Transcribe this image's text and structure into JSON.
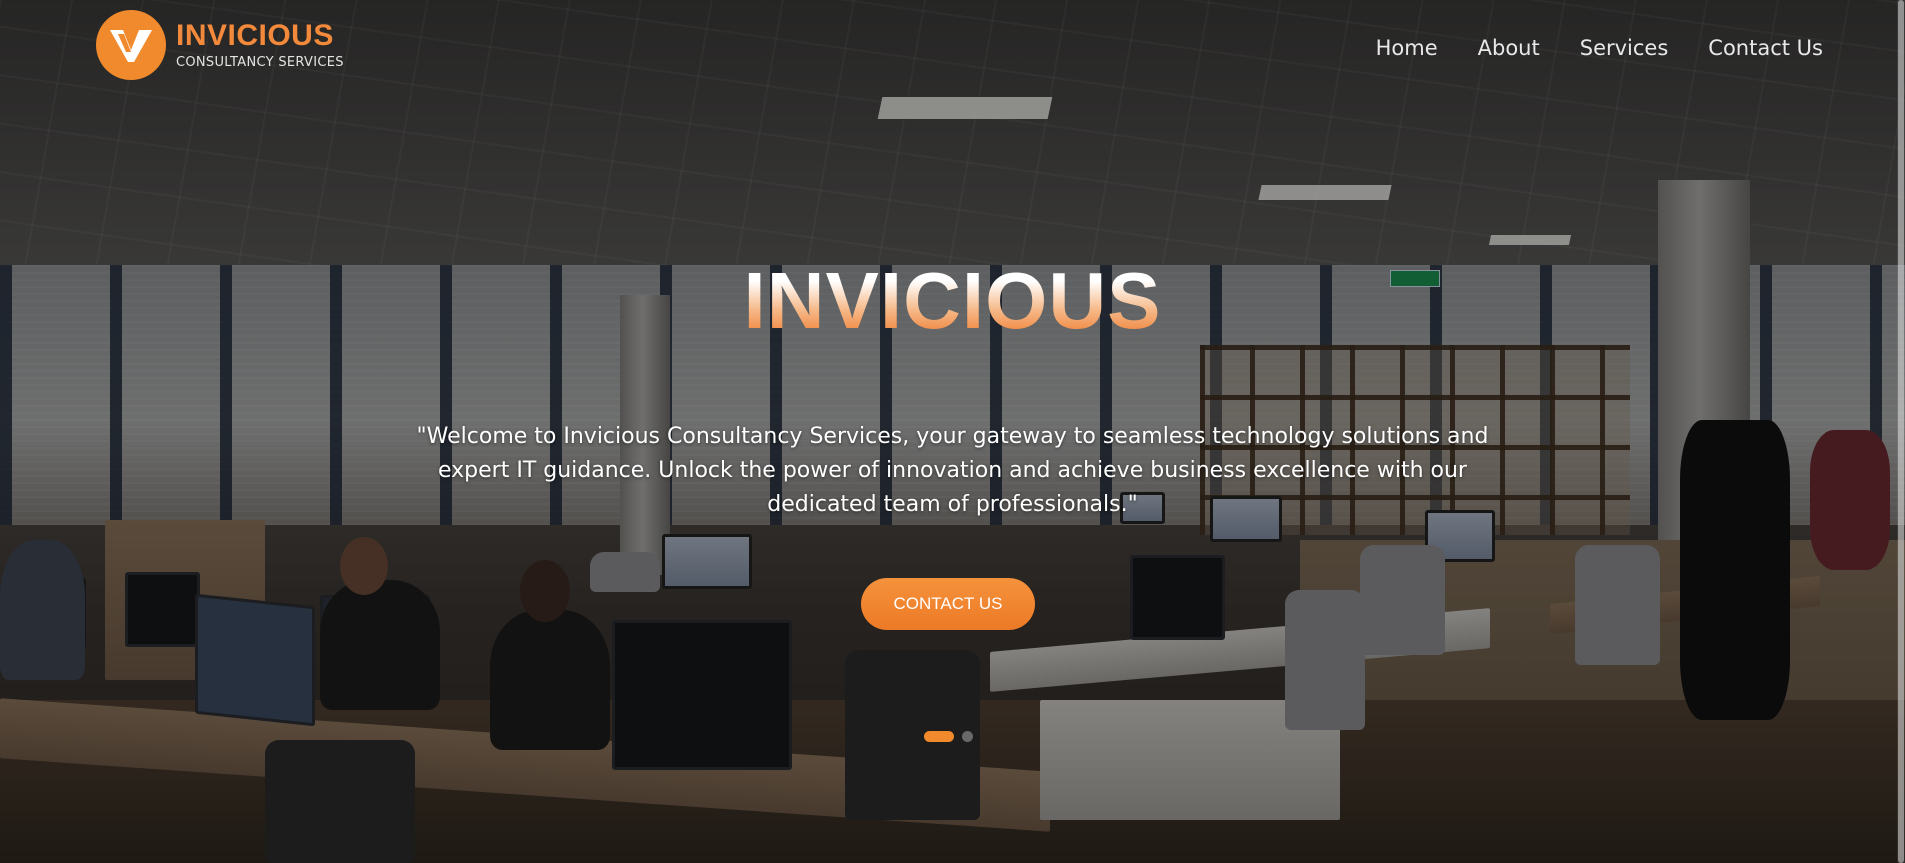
{
  "brand": {
    "name": "INVICIOUS",
    "tagline": "CONSULTANCY SERVICES",
    "accent": "#f08a2c",
    "logo_icon": "v-logo-icon"
  },
  "nav": {
    "items": [
      {
        "label": "Home"
      },
      {
        "label": "About"
      },
      {
        "label": "Services"
      },
      {
        "label": "Contact Us"
      }
    ]
  },
  "hero": {
    "title": "INVICIOUS",
    "text": "\"Welcome to Invicious Consultancy Services, your gateway to seamless technology solutions and expert IT guidance. Unlock the power of innovation and achieve business excellence with our dedicated team of professionals.\"",
    "cta_label": "CONTACT US",
    "background": "office-photo",
    "carousel": {
      "slides": 2,
      "active": 1
    }
  },
  "colors": {
    "cta": "#f08a2c",
    "text": "#ffffff"
  }
}
